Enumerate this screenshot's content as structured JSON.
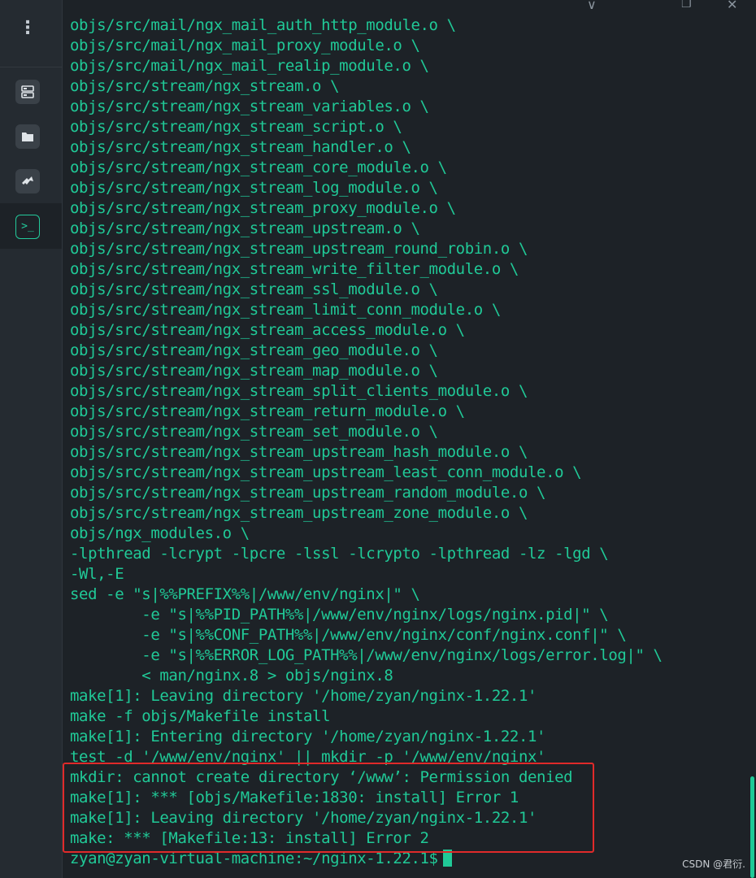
{
  "window": {
    "minimize_glyph": "∨",
    "restore_glyph": "❐",
    "close_glyph": "✕"
  },
  "sidebar": {
    "menu_glyph": "⋮",
    "terminal_glyph": ">_"
  },
  "terminal": {
    "lines": [
      "objs/src/mail/ngx_mail_auth_http_module.o \\",
      "objs/src/mail/ngx_mail_proxy_module.o \\",
      "objs/src/mail/ngx_mail_realip_module.o \\",
      "objs/src/stream/ngx_stream.o \\",
      "objs/src/stream/ngx_stream_variables.o \\",
      "objs/src/stream/ngx_stream_script.o \\",
      "objs/src/stream/ngx_stream_handler.o \\",
      "objs/src/stream/ngx_stream_core_module.o \\",
      "objs/src/stream/ngx_stream_log_module.o \\",
      "objs/src/stream/ngx_stream_proxy_module.o \\",
      "objs/src/stream/ngx_stream_upstream.o \\",
      "objs/src/stream/ngx_stream_upstream_round_robin.o \\",
      "objs/src/stream/ngx_stream_write_filter_module.o \\",
      "objs/src/stream/ngx_stream_ssl_module.o \\",
      "objs/src/stream/ngx_stream_limit_conn_module.o \\",
      "objs/src/stream/ngx_stream_access_module.o \\",
      "objs/src/stream/ngx_stream_geo_module.o \\",
      "objs/src/stream/ngx_stream_map_module.o \\",
      "objs/src/stream/ngx_stream_split_clients_module.o \\",
      "objs/src/stream/ngx_stream_return_module.o \\",
      "objs/src/stream/ngx_stream_set_module.o \\",
      "objs/src/stream/ngx_stream_upstream_hash_module.o \\",
      "objs/src/stream/ngx_stream_upstream_least_conn_module.o \\",
      "objs/src/stream/ngx_stream_upstream_random_module.o \\",
      "objs/src/stream/ngx_stream_upstream_zone_module.o \\",
      "objs/ngx_modules.o \\",
      "-lpthread -lcrypt -lpcre -lssl -lcrypto -lpthread -lz -lgd \\",
      "-Wl,-E",
      "sed -e \"s|%%PREFIX%%|/www/env/nginx|\" \\",
      "        -e \"s|%%PID_PATH%%|/www/env/nginx/logs/nginx.pid|\" \\",
      "        -e \"s|%%CONF_PATH%%|/www/env/nginx/conf/nginx.conf|\" \\",
      "        -e \"s|%%ERROR_LOG_PATH%%|/www/env/nginx/logs/error.log|\" \\",
      "        < man/nginx.8 > objs/nginx.8",
      "make[1]: Leaving directory '/home/zyan/nginx-1.22.1'",
      "make -f objs/Makefile install",
      "make[1]: Entering directory '/home/zyan/nginx-1.22.1'",
      "test -d '/www/env/nginx' || mkdir -p '/www/env/nginx'",
      "mkdir: cannot create directory ‘/www’: Permission denied",
      "make[1]: *** [objs/Makefile:1830: install] Error 1",
      "make[1]: Leaving directory '/home/zyan/nginx-1.22.1'",
      "make: *** [Makefile:13: install] Error 2"
    ],
    "prompt": "zyan@zyan-virtual-machine:~/nginx-1.22.1$"
  },
  "watermark": "CSDN @君衍."
}
